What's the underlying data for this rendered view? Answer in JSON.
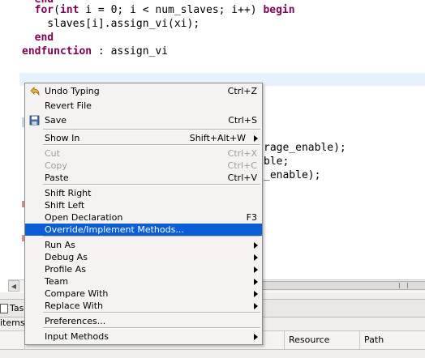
{
  "editor": {
    "lines": [
      {
        "parts": [
          {
            "t": "  ",
            "k": false
          },
          {
            "t": "end",
            "k": true
          }
        ]
      },
      {
        "parts": [
          {
            "t": "  ",
            "k": false
          },
          {
            "t": "for",
            "k": true
          },
          {
            "t": "(",
            "k": false
          },
          {
            "t": "int",
            "k": true
          },
          {
            "t": " i = 0; i < num_slaves; i++) ",
            "k": false
          },
          {
            "t": "begin",
            "k": true
          }
        ]
      },
      {
        "parts": [
          {
            "t": "    slaves[i].assign_vi(xi);",
            "k": false
          }
        ]
      },
      {
        "parts": [
          {
            "t": "  ",
            "k": false
          },
          {
            "t": "end",
            "k": true
          }
        ]
      },
      {
        "parts": [
          {
            "t": "endfunction",
            "k": true
          },
          {
            "t": " : assign_vi",
            "k": false
          }
        ]
      }
    ],
    "partial_lines": [
      "rage_enable);",
      "ble;",
      "_enable);"
    ]
  },
  "bottom_panel": {
    "tab_label": "Tas",
    "items_label": "items",
    "columns": [
      "Resource",
      "Path"
    ]
  },
  "context_menu": {
    "items": [
      {
        "label": "Undo Typing",
        "shortcut": "Ctrl+Z",
        "icon": "undo-icon"
      },
      {
        "label": "Revert File",
        "shortcut": ""
      },
      {
        "label": "Save",
        "shortcut": "Ctrl+S",
        "icon": "save-icon"
      },
      {
        "label": "Show In",
        "shortcut": "Shift+Alt+W",
        "submenu": true
      },
      {
        "label": "Cut",
        "shortcut": "Ctrl+X",
        "disabled": true
      },
      {
        "label": "Copy",
        "shortcut": "Ctrl+C",
        "disabled": true
      },
      {
        "label": "Paste",
        "shortcut": "Ctrl+V"
      },
      {
        "label": "Shift Right",
        "shortcut": ""
      },
      {
        "label": "Shift Left",
        "shortcut": ""
      },
      {
        "label": "Open Declaration",
        "shortcut": "F3"
      },
      {
        "label": "Override/Implement Methods...",
        "shortcut": "",
        "highlight": true
      },
      {
        "label": "Run As",
        "submenu": true
      },
      {
        "label": "Debug As",
        "submenu": true
      },
      {
        "label": "Profile As",
        "submenu": true
      },
      {
        "label": "Team",
        "submenu": true
      },
      {
        "label": "Compare With",
        "submenu": true
      },
      {
        "label": "Replace With",
        "submenu": true
      },
      {
        "label": "Preferences..."
      },
      {
        "label": "Input Methods",
        "submenu": true
      }
    ]
  },
  "colors": {
    "keyword": "#7f0055",
    "highlight": "#0a5fd8",
    "current_line": "#e8f2fe"
  }
}
